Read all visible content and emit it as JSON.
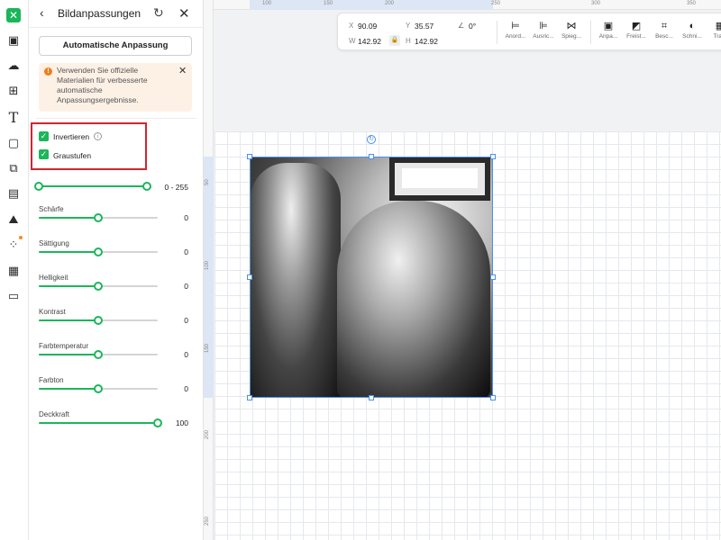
{
  "panel": {
    "title": "Bildanpassungen",
    "auto_button": "Automatische Anpassung",
    "notice": "Verwenden Sie offizielle Materialien für verbesserte automatische Anpassungsergebnisse.",
    "checkboxes": [
      {
        "label": "Invertieren",
        "checked": true
      },
      {
        "label": "Graustufen",
        "checked": true
      }
    ],
    "range_slider": {
      "min": 0,
      "max": 255,
      "display": "0 - 255"
    },
    "sliders": [
      {
        "label": "Schärfe",
        "value": "0",
        "level": 0.5
      },
      {
        "label": "Sättigung",
        "value": "0",
        "level": 0.5
      },
      {
        "label": "Helligkeit",
        "value": "0",
        "level": 0.5
      },
      {
        "label": "Kontrast",
        "value": "0",
        "level": 0.5
      },
      {
        "label": "Farbtemperatur",
        "value": "0",
        "level": 0.5
      },
      {
        "label": "Farbton",
        "value": "0",
        "level": 0.5
      },
      {
        "label": "Deckkraft",
        "value": "100",
        "level": 1.0
      }
    ]
  },
  "toolbar": {
    "x_label": "X",
    "x_value": "90.09",
    "y_label": "Y",
    "y_value": "35.57",
    "w_label": "W",
    "w_value": "142.92",
    "h_label": "H",
    "h_value": "142.92",
    "rotation": "0°",
    "tools": [
      {
        "label": "Anord...",
        "icon": "arrange-icon"
      },
      {
        "label": "Ausric...",
        "icon": "align-icon"
      },
      {
        "label": "Spieg...",
        "icon": "mirror-icon"
      },
      {
        "label": "Anpa...",
        "icon": "adjust-icon"
      },
      {
        "label": "Freist...",
        "icon": "cutout-icon"
      },
      {
        "label": "Besc...",
        "icon": "crop-icon"
      },
      {
        "label": "Schni...",
        "icon": "mask-icon"
      },
      {
        "label": "Tra...",
        "icon": "transparency-icon"
      }
    ]
  },
  "rulers": {
    "top": [
      "100",
      "150",
      "200",
      "250",
      "300",
      "350"
    ],
    "left": [
      "50",
      "100",
      "150",
      "200",
      "250"
    ]
  },
  "colors": {
    "accent": "#1bb65a",
    "highlight_box": "#d32531",
    "selection": "#4d8fe8",
    "notice_bg": "#fdf1e6",
    "warning": "#ef7d1a"
  }
}
